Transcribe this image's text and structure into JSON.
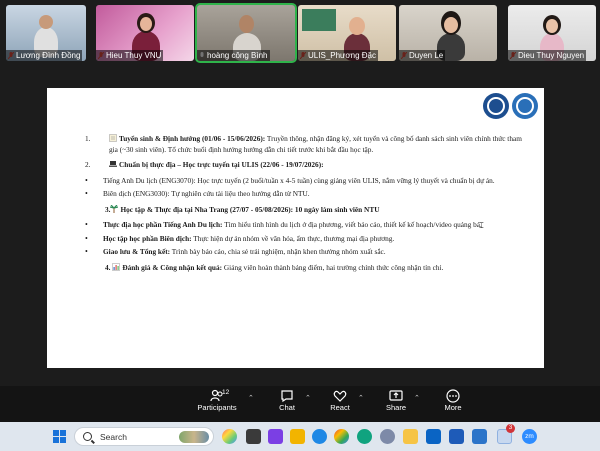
{
  "participants": [
    {
      "name": "Lương Đình Đồng"
    },
    {
      "name": "Hieu Thuy VNU"
    },
    {
      "name": "hoàng công Bình"
    },
    {
      "name": "ULIS_Phương Đặc"
    },
    {
      "name": "Duyen Le"
    },
    {
      "name": "Dieu Thuy Nguyen"
    }
  ],
  "slide": {
    "items": [
      {
        "number": "1.",
        "title": "Tuyển sinh & Định hướng (01/06 - 15/06/2026):",
        "text": " Truyền thông, nhận đăng ký, xét tuyển và công bố danh sách sinh viên chính thức tham gia (~30 sinh viên). Tổ chức buổi định hướng hướng dẫn chi tiết trước khi bắt đầu học tập."
      },
      {
        "number": "2.",
        "title": "Chuẩn bị thực địa – Học trực tuyến tại ULIS (22/06 - 19/07/2026):",
        "subs": [
          {
            "text": "Tiếng Anh Du lịch (ENG3070): Học trực tuyến (2 buổi/tuần x 4-5 tuần) cùng giảng viên ULIS, nắm vững lý thuyết và chuẩn bị dự án."
          },
          {
            "text": "Biên dịch (ENG3030): Tự nghiên cứu tài liệu theo hướng dẫn từ NTU."
          }
        ]
      },
      {
        "number": "3.",
        "title": "Học tập & Thực địa tại Nha Trang (27/07 - 05/08/2026): 10 ngày làm sinh viên NTU",
        "subs": [
          {
            "label": "Thực địa học phần Tiếng Anh Du lịch:",
            "text": " Tìm hiểu tình hình du lịch ở địa phương, viết báo cáo, thiết kế kế hoạch/video quảng bá."
          },
          {
            "label": "Học tập học phần Biên dịch:",
            "text": " Thực hiện dự án nhóm về văn hóa, ẩm thực, thương mại địa phương."
          },
          {
            "label": "Giao lưu & Tổng kết:",
            "text": " Trình bày báo cáo, chia sẻ trải nghiệm, nhận khen thưởng nhóm xuất sắc."
          }
        ]
      },
      {
        "number": "4.",
        "title": "Đánh giá & Công nhận kết quả:",
        "text": " Giảng viên hoàn thành bảng điểm, hai trường chính thức công nhận tín chỉ."
      }
    ]
  },
  "toolbar": {
    "participants_label": "Participants",
    "participants_count": "12",
    "chat_label": "Chat",
    "react_label": "React",
    "share_label": "Share",
    "more_label": "More"
  },
  "taskbar": {
    "search_placeholder": "Search",
    "teams_badge": "3",
    "zoom_label": "zm"
  },
  "colors": {
    "active_speaker": "#2fb34a",
    "toolbar_bg": "#141414",
    "taskbar_bg": "#dfe6ee"
  }
}
